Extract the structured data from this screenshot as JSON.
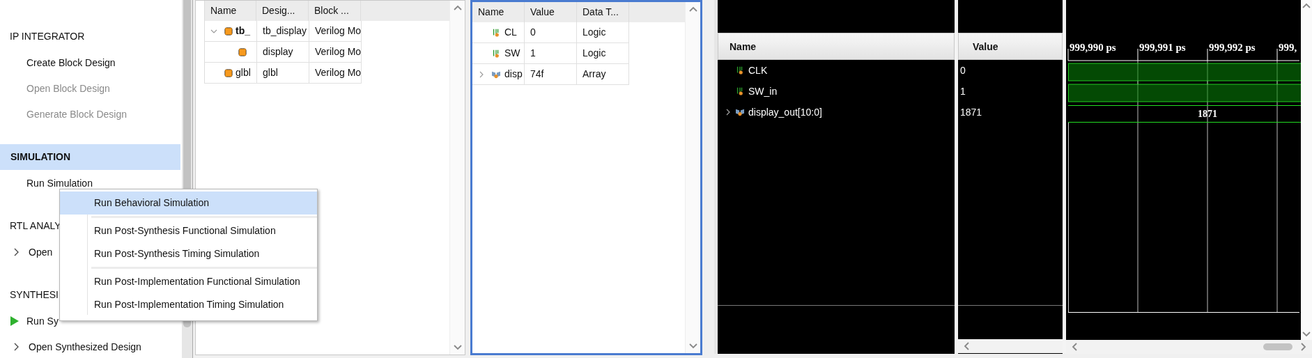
{
  "flow_navigator": {
    "sections": [
      {
        "title": "IP INTEGRATOR",
        "selected": false,
        "items": [
          {
            "label": "Create Block Design",
            "kind": "plain",
            "disabled": false
          },
          {
            "label": "Open Block Design",
            "kind": "plain",
            "disabled": true
          },
          {
            "label": "Generate Block Design",
            "kind": "plain",
            "disabled": true
          }
        ]
      },
      {
        "title": "SIMULATION",
        "selected": true,
        "items": [
          {
            "label": "Run Simulation",
            "kind": "plain",
            "disabled": false
          }
        ]
      },
      {
        "title": "RTL ANALY",
        "selected": false,
        "items": [
          {
            "label": "Open",
            "kind": "expandable",
            "expanded": false,
            "disabled": false
          }
        ]
      },
      {
        "title": "SYNTHESI",
        "selected": false,
        "items": [
          {
            "label": "Run Sy",
            "kind": "run",
            "disabled": false
          },
          {
            "label": "Open Synthesized Design",
            "kind": "expandable",
            "expanded": false,
            "disabled": false
          }
        ]
      }
    ]
  },
  "context_menu": {
    "groups": [
      {
        "items": [
          {
            "label": "Run Behavioral Simulation",
            "selected": true
          }
        ]
      },
      {
        "items": [
          {
            "label": "Run Post-Synthesis Functional Simulation",
            "selected": false
          },
          {
            "label": "Run Post-Synthesis Timing Simulation",
            "selected": false
          }
        ]
      },
      {
        "items": [
          {
            "label": "Run Post-Implementation Functional Simulation",
            "selected": false
          },
          {
            "label": "Run Post-Implementation Timing Simulation",
            "selected": false
          }
        ]
      }
    ]
  },
  "hierarchy": {
    "columns": [
      "Name",
      "Desig...",
      "Block ..."
    ],
    "rows": [
      {
        "name": "tb_",
        "design": "tb_display",
        "block": "Verilog Mo",
        "expanded": true,
        "children": [
          {
            "design": "display",
            "block": "Verilog Mo"
          }
        ]
      },
      {
        "name": "glbl",
        "design": "glbl",
        "block": "Verilog Mo"
      }
    ]
  },
  "objects": {
    "columns": [
      "Name",
      "Value",
      "Data T..."
    ],
    "rows": [
      {
        "name": "CL",
        "value": "0",
        "type": "Logic",
        "kind": "logic"
      },
      {
        "name": "SW",
        "value": "1",
        "type": "Logic",
        "kind": "logic"
      },
      {
        "name": "disp",
        "value": "74f",
        "type": "Array",
        "kind": "array",
        "expanded": false
      }
    ]
  },
  "wave": {
    "name_header": "Name",
    "value_header": "Value",
    "time_ticks": [
      "999,990 ps",
      "999,991 ps",
      "999,992 ps",
      "999,"
    ],
    "signals": [
      {
        "name": "CLK",
        "value": "0",
        "kind": "logic"
      },
      {
        "name": "SW_in",
        "value": "1",
        "kind": "logic"
      },
      {
        "name": "display_out[10:0]",
        "value": "1871",
        "kind": "bus",
        "expanded": false,
        "wave_label": "1871"
      }
    ]
  }
}
